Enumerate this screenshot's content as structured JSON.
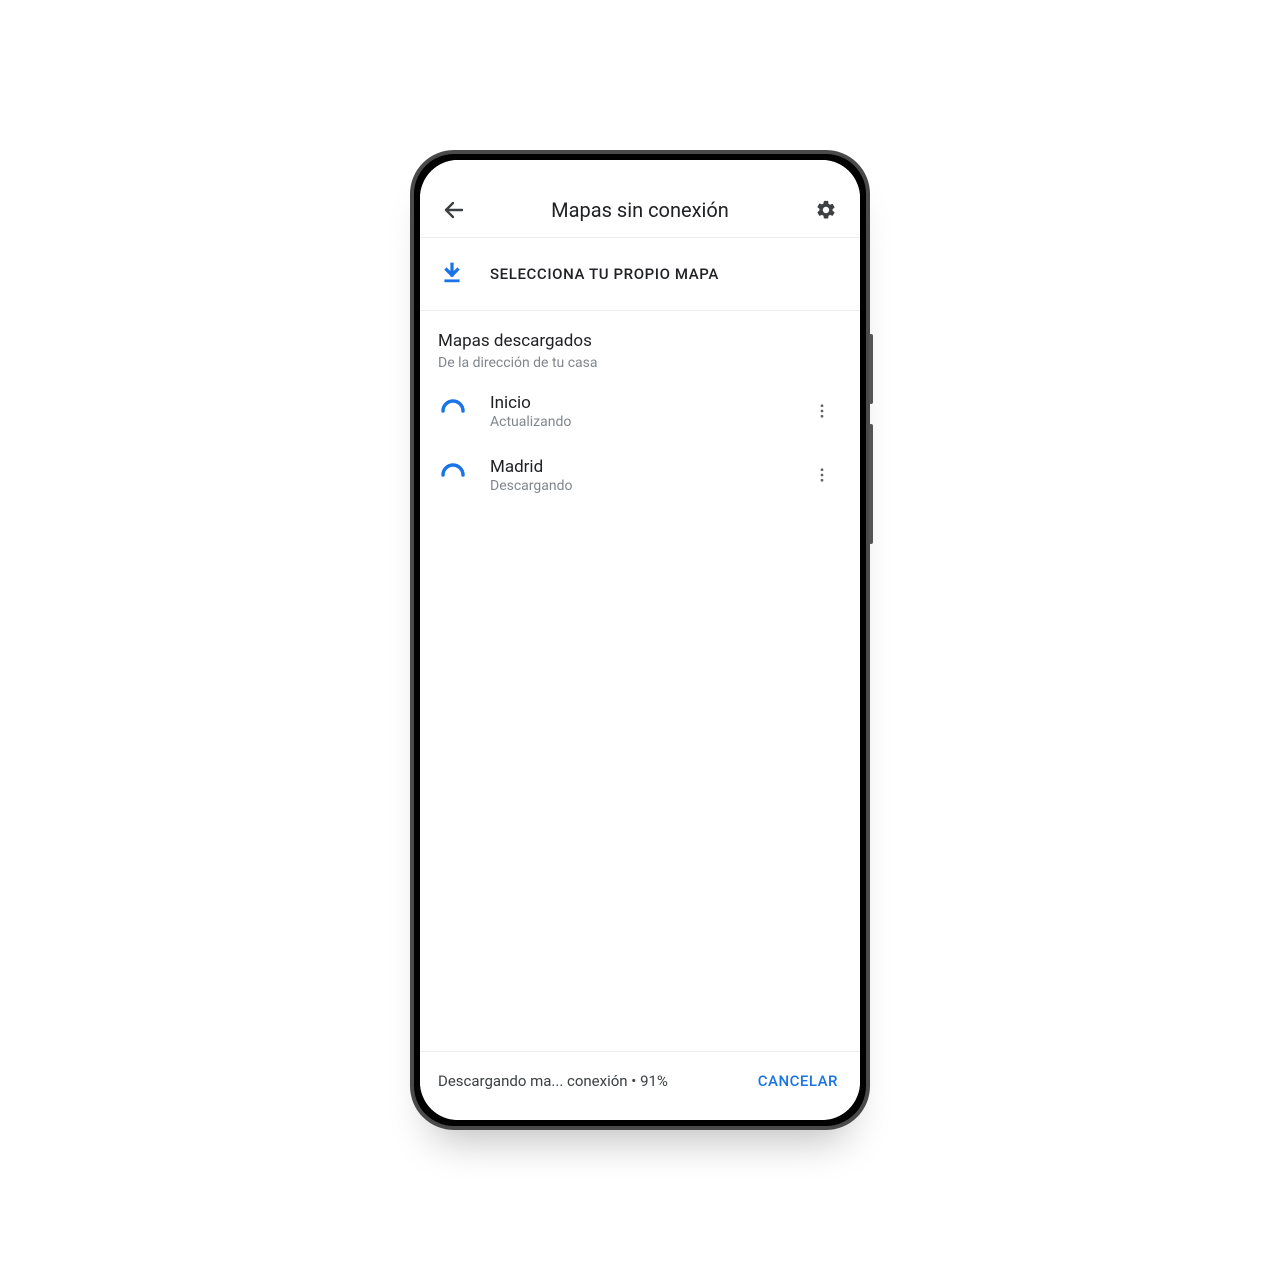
{
  "colors": {
    "accent": "#1a73e8",
    "text_primary": "#202124",
    "text_secondary": "#80868b"
  },
  "header": {
    "title": "Mapas sin conexión"
  },
  "select_map": {
    "label": "SELECCIONA TU PROPIO MAPA"
  },
  "section": {
    "title": "Mapas descargados",
    "subtitle": "De la dirección de tu casa"
  },
  "maps": [
    {
      "name": "Inicio",
      "status": "Actualizando"
    },
    {
      "name": "Madrid",
      "status": "Descargando"
    }
  ],
  "footer": {
    "status_text": "Descargando ma... conexión • 91%",
    "progress_percent": 91,
    "cancel_label": "CANCELAR"
  }
}
